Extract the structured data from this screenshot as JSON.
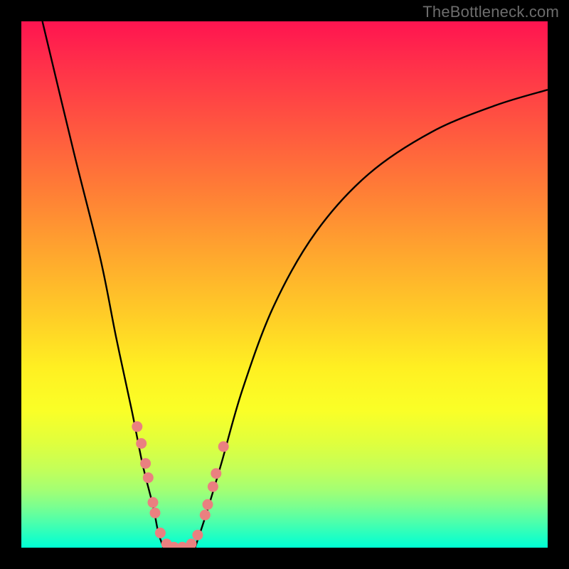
{
  "watermark": "TheBottleneck.com",
  "chart_data": {
    "type": "line",
    "title": "",
    "xlabel": "",
    "ylabel": "",
    "xlim": [
      0,
      100
    ],
    "ylim": [
      0,
      100
    ],
    "note": "Axes are unlabeled in the image; values are estimated from pixel positions on a 0–100 scale.",
    "series": [
      {
        "name": "left-branch",
        "x": [
          4,
          10,
          15,
          18,
          21,
          23,
          25,
          26,
          27
        ],
        "y": [
          100,
          75,
          55,
          40,
          26,
          16,
          8,
          3,
          0
        ]
      },
      {
        "name": "trough",
        "x": [
          27,
          29,
          31,
          33
        ],
        "y": [
          0,
          0,
          0,
          0
        ]
      },
      {
        "name": "right-branch",
        "x": [
          33,
          35,
          38,
          42,
          48,
          56,
          66,
          78,
          90,
          100
        ],
        "y": [
          0,
          6,
          16,
          30,
          46,
          60,
          71,
          79,
          84,
          87
        ]
      }
    ],
    "beads": {
      "name": "highlight-points",
      "note": "Coral bead markers near the trough; visual only, grouped into left-cluster, bottom-cluster, right-cluster.",
      "points": [
        {
          "x": 22.0,
          "y": 23.0
        },
        {
          "x": 22.8,
          "y": 19.8
        },
        {
          "x": 23.6,
          "y": 16.0
        },
        {
          "x": 24.1,
          "y": 13.3
        },
        {
          "x": 25.0,
          "y": 8.6
        },
        {
          "x": 25.4,
          "y": 6.6
        },
        {
          "x": 26.4,
          "y": 2.8
        },
        {
          "x": 27.6,
          "y": 0.7
        },
        {
          "x": 29.0,
          "y": 0.1
        },
        {
          "x": 30.6,
          "y": 0.1
        },
        {
          "x": 32.3,
          "y": 0.7
        },
        {
          "x": 33.5,
          "y": 2.4
        },
        {
          "x": 34.9,
          "y": 6.2
        },
        {
          "x": 35.4,
          "y": 8.2
        },
        {
          "x": 36.4,
          "y": 11.6
        },
        {
          "x": 37.0,
          "y": 14.1
        },
        {
          "x": 38.4,
          "y": 19.2
        }
      ]
    },
    "colors": {
      "curve": "#000000",
      "beads": "#ea8080",
      "background_top": "#ff1450",
      "background_bottom": "#00ffd4",
      "frame": "#000000"
    }
  }
}
